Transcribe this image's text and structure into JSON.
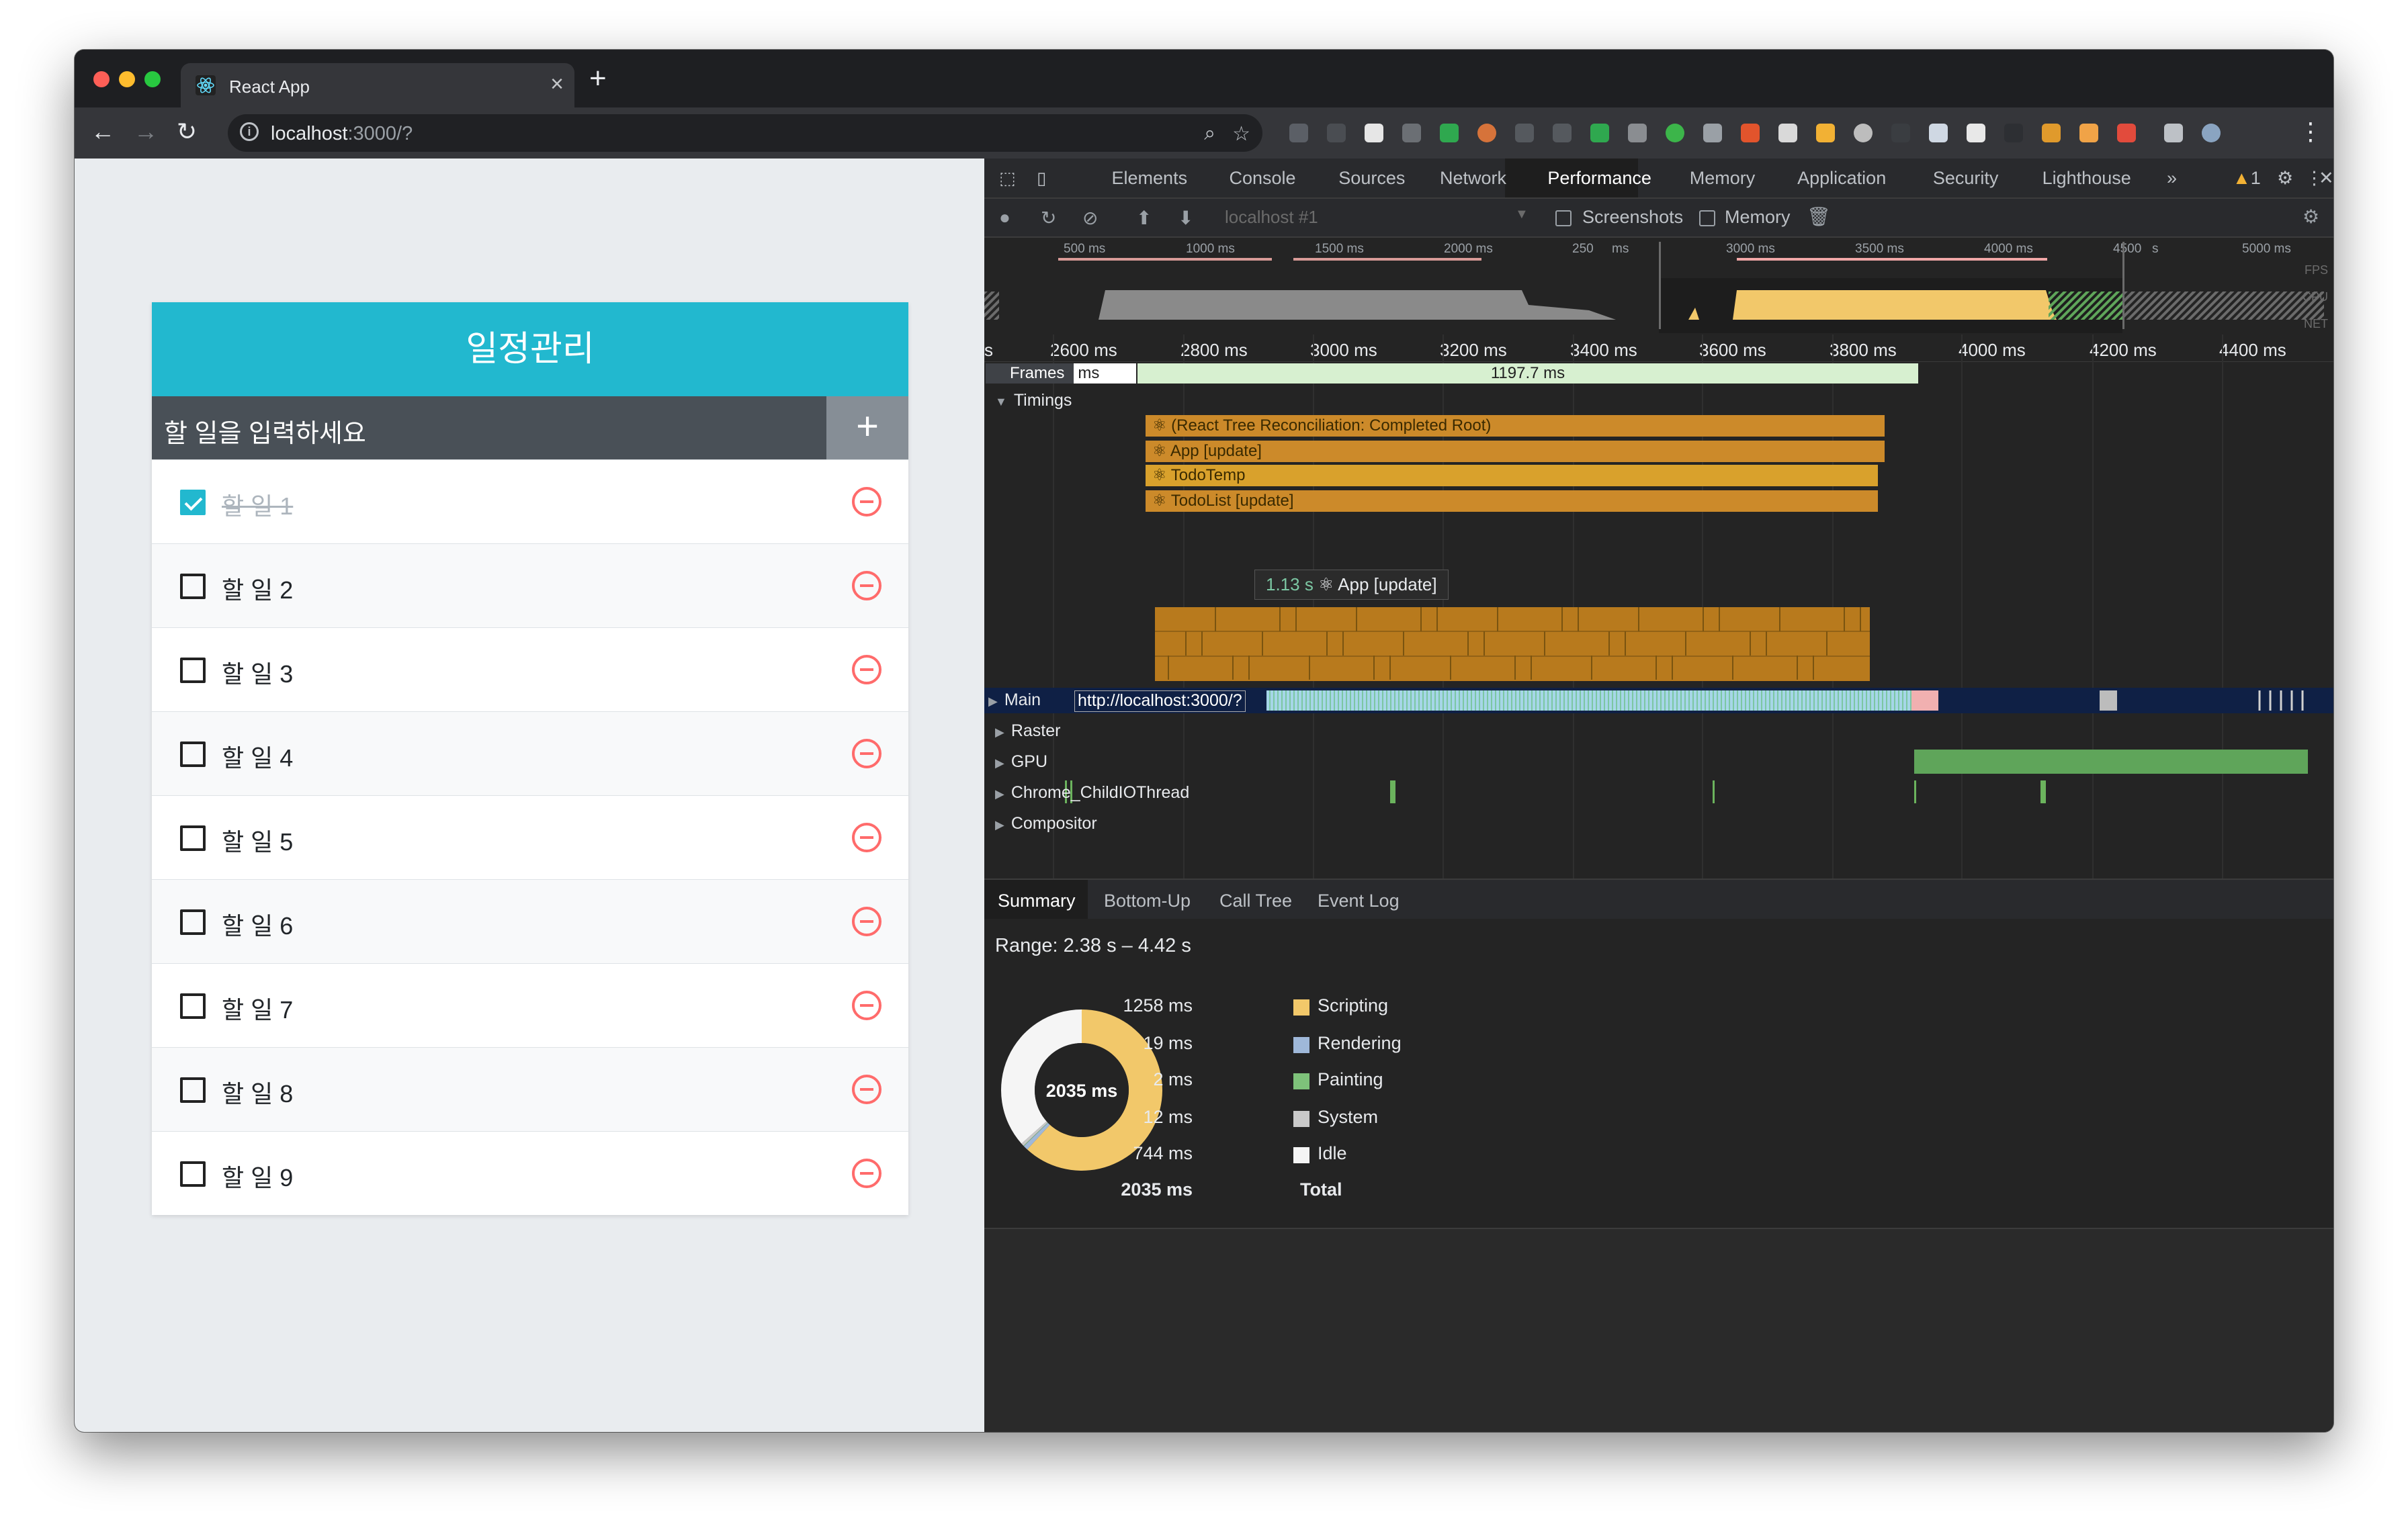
{
  "browser": {
    "tab_title": "React App",
    "url_host": "localhost",
    "url_rest": ":3000/?"
  },
  "app": {
    "title": "일정관리",
    "input_placeholder": "할 일을 입력하세요",
    "add_label": "+",
    "items": [
      {
        "text": "할 일 1",
        "checked": true
      },
      {
        "text": "할 일 2",
        "checked": false
      },
      {
        "text": "할 일 3",
        "checked": false
      },
      {
        "text": "할 일 4",
        "checked": false
      },
      {
        "text": "할 일 5",
        "checked": false
      },
      {
        "text": "할 일 6",
        "checked": false
      },
      {
        "text": "할 일 7",
        "checked": false
      },
      {
        "text": "할 일 8",
        "checked": false
      },
      {
        "text": "할 일 9",
        "checked": false
      }
    ]
  },
  "devtools": {
    "tabs": [
      "Elements",
      "Console",
      "Sources",
      "Network",
      "Performance",
      "Memory",
      "Application",
      "Security",
      "Lighthouse"
    ],
    "active_tab": "Performance",
    "more": "»",
    "warning_count": "1",
    "profile_select": "localhost #1",
    "screenshots_label": "Screenshots",
    "memory_label": "Memory",
    "overview_ticks": [
      "500 ms",
      "1000 ms",
      "1500 ms",
      "2000 ms",
      "250",
      "ms",
      "3000 ms",
      "3500 ms",
      "4000 ms",
      "4500",
      "s",
      "5000 ms"
    ],
    "overview_side": [
      "FPS",
      "CPU",
      "NET"
    ],
    "ruler_ticks": [
      "s",
      "2600 ms",
      "2800 ms",
      "3000 ms",
      "3200 ms",
      "3400 ms",
      "3600 ms",
      "3800 ms",
      "4000 ms",
      "4200 ms",
      "4400 ms"
    ],
    "frames_label": "Frames",
    "frames_ms": "ms",
    "frames_value": "1197.7 ms",
    "timings_label": "Timings",
    "timings": [
      "⚛ (React Tree Reconciliation: Completed Root)",
      "⚛ App [update]",
      "⚛ TodoTemp",
      "⚛ TodoList [update]"
    ],
    "tooltip_time": "1.13 s",
    "tooltip_label": "⚛ App [update]",
    "tracks": [
      "Main",
      "Raster",
      "GPU",
      "Chrome_ChildIOThread",
      "Compositor"
    ],
    "main_url": "http://localhost:3000/?",
    "bottom_tabs": [
      "Summary",
      "Bottom-Up",
      "Call Tree",
      "Event Log"
    ],
    "range": "Range: 2.38 s – 4.42 s",
    "donut_label": "2035 ms",
    "summary": [
      {
        "value": "1258 ms",
        "name": "Scripting",
        "color": "#f2c86a",
        "ms": 1258
      },
      {
        "value": "19 ms",
        "name": "Rendering",
        "color": "#9fb8d9",
        "ms": 19
      },
      {
        "value": "2 ms",
        "name": "Painting",
        "color": "#7ec27a",
        "ms": 2
      },
      {
        "value": "12 ms",
        "name": "System",
        "color": "#c9c9c9",
        "ms": 12
      },
      {
        "value": "744 ms",
        "name": "Idle",
        "color": "#f5f5f5",
        "ms": 744
      }
    ],
    "total_value": "2035 ms",
    "total_label": "Total"
  }
}
